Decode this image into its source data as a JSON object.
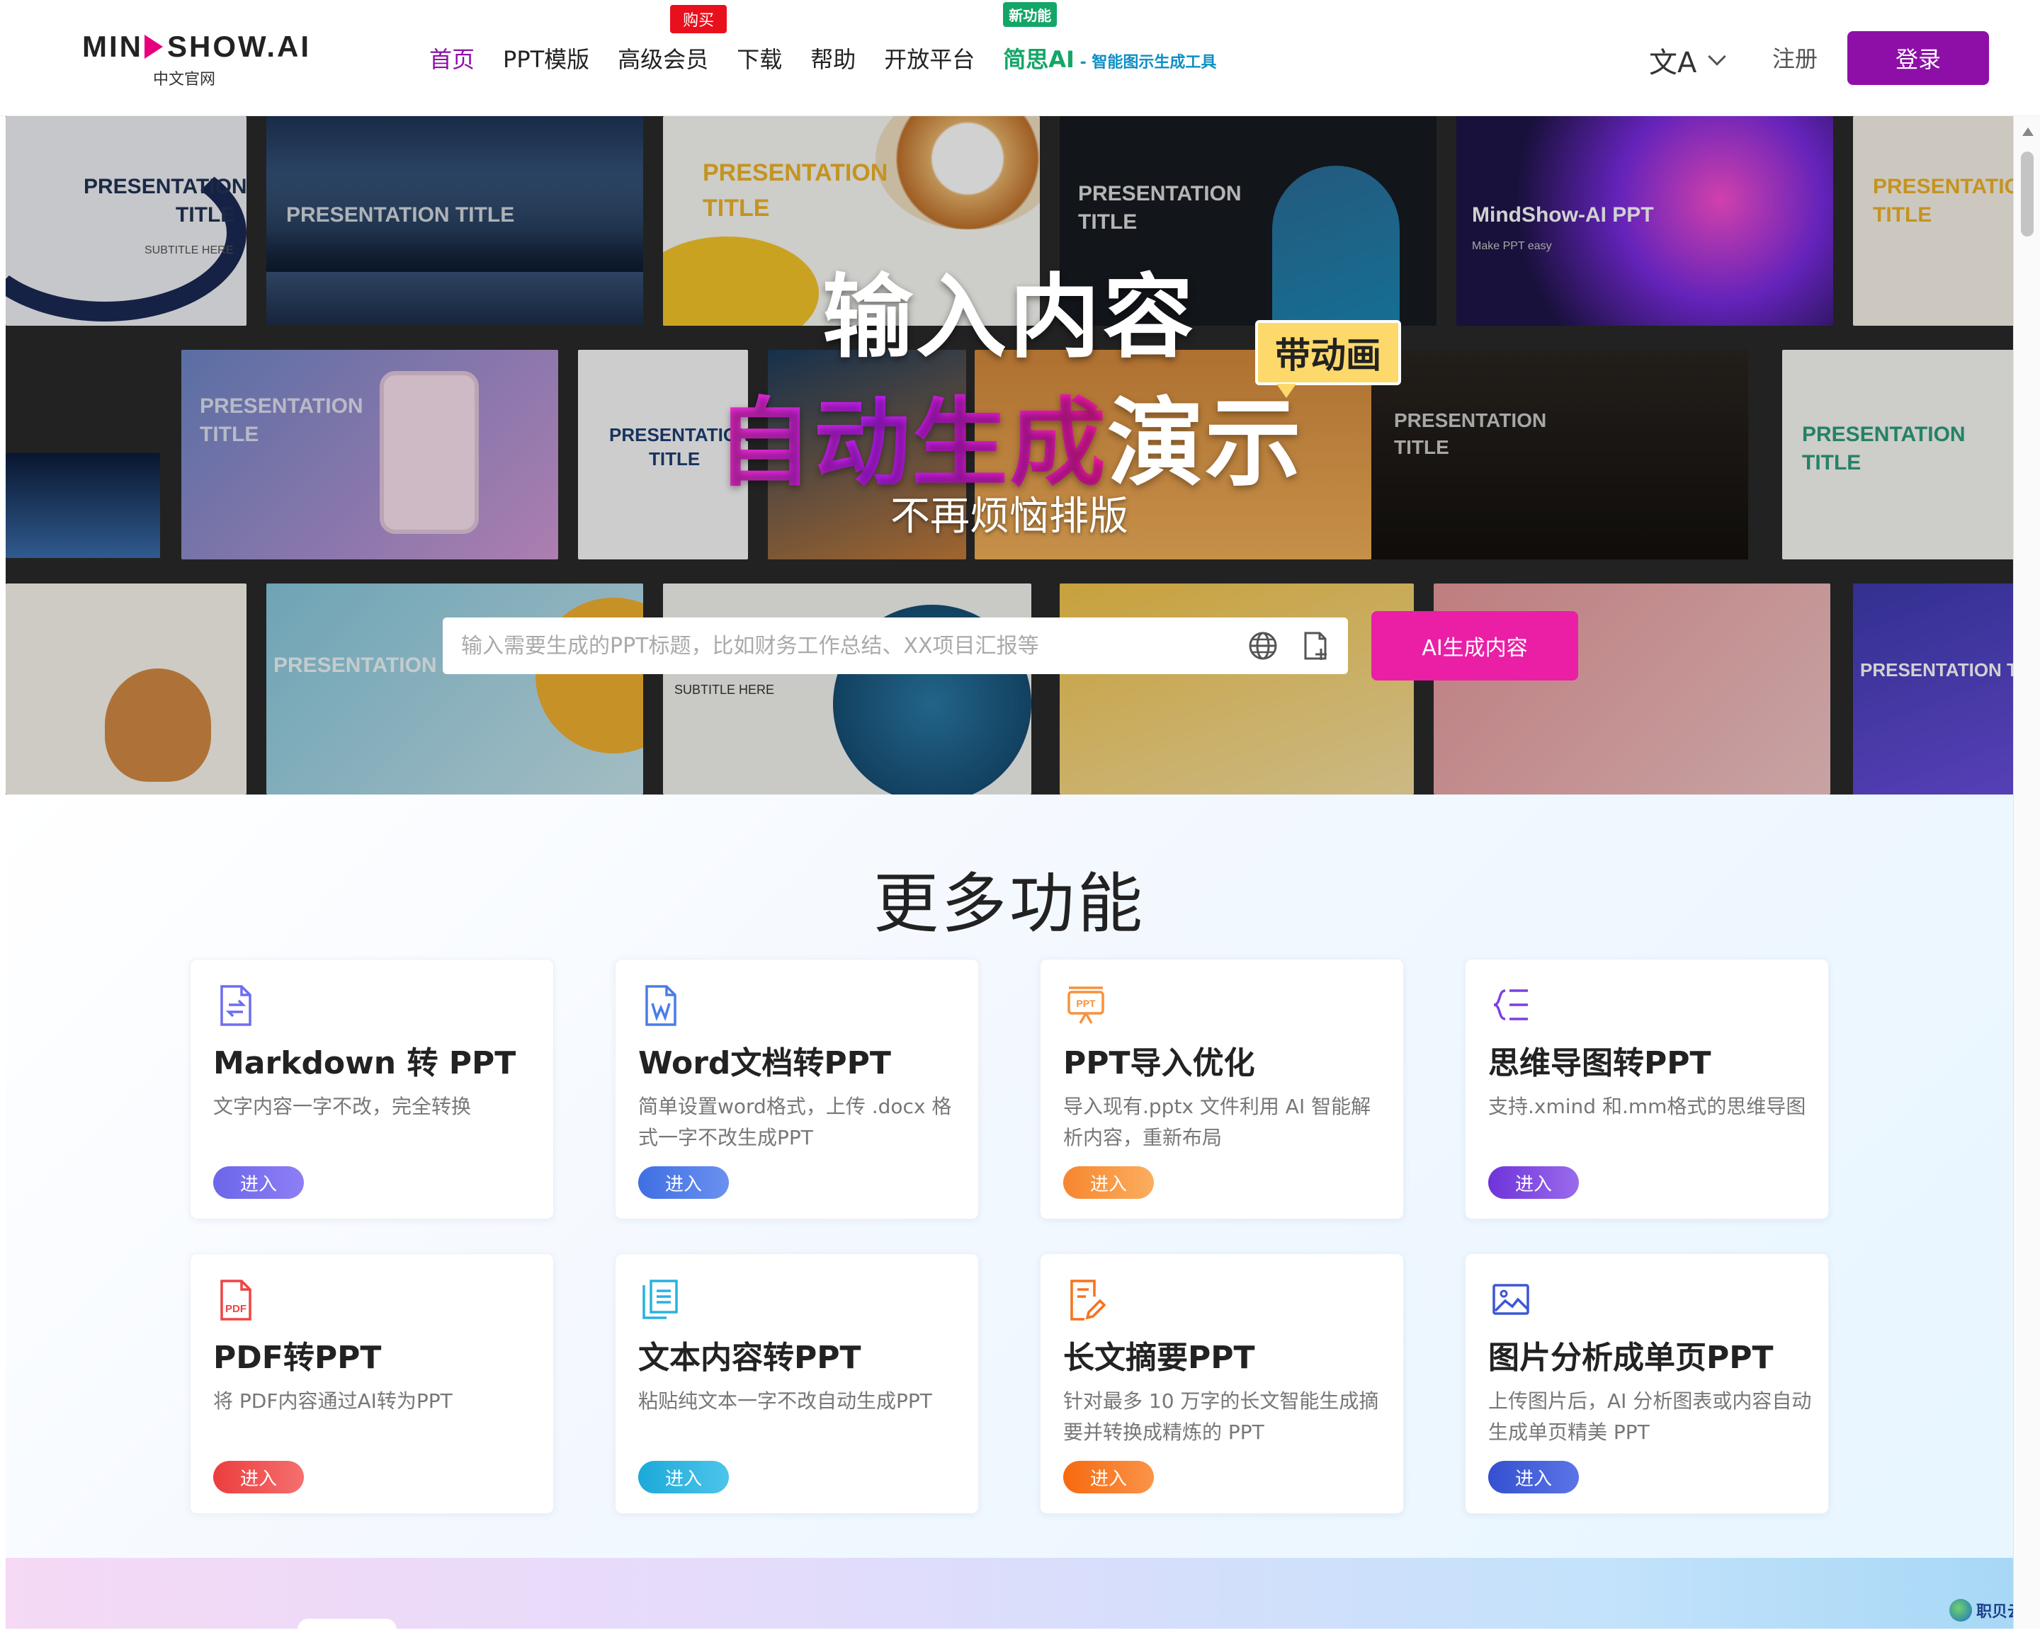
{
  "header": {
    "logo_main_a": "MIN",
    "logo_main_b": "SHOW.AI",
    "logo_sub": "中文官网",
    "nav": [
      {
        "label": "首页"
      },
      {
        "label": "PPT模版"
      },
      {
        "label": "高级会员",
        "badge": "购买"
      },
      {
        "label": "下载"
      },
      {
        "label": "帮助"
      },
      {
        "label": "开放平台"
      },
      {
        "label": "简思AI",
        "tail": " - 智能图示生成工具",
        "badge": "新功能"
      }
    ],
    "lang_icon": "文A",
    "register": "注册",
    "login": "登录"
  },
  "hero": {
    "line1": "输入内容",
    "line2_grad": "自动生成",
    "line2_white": "演示",
    "tag": "带动画",
    "line3": "不再烦恼排版",
    "search_placeholder": "输入需要生成的PPT标题，比如财务工作总结、XX项目汇报等",
    "ai_button": "AI生成内容",
    "thumb_texts": {
      "t1": "PRESENTATION",
      "t1b": "TITLE",
      "t1s": "SUBTITLE HERE",
      "t2": "PRESENTATION TITLE",
      "t3": "PRESENTATION",
      "t3b": "TITLE",
      "t4": "PRESENTATION",
      "t4b": "TITLE",
      "t5": "MindShow-AI PPT",
      "t5s": "Make PPT easy",
      "t6": "PRESENTATIO",
      "t6b": "TITLE",
      "t7": "PRESENTATION",
      "t7b": "TITLE",
      "t8": "PRESENTATION",
      "t8b": "TITLE",
      "t9": "PRESENTATION",
      "t9b": "TITLE",
      "t10": "PRESENTATION",
      "t10b": "TITLE",
      "t11": "PRESENTATION TITLE",
      "t12": "SUBTITLE HERE",
      "t13": "PRESENTATION TI"
    }
  },
  "features": {
    "title": "更多功能",
    "cards": [
      {
        "title": "Markdown 转 PPT",
        "desc": "文字内容一字不改，完全转换",
        "enter": "进入",
        "color": "#6e6df0",
        "icon": "markdown-file-icon"
      },
      {
        "title": "Word文档转PPT",
        "desc": "简单设置word格式，上传 .docx 格式一字不改生成PPT",
        "enter": "进入",
        "color": "#4a7de8",
        "icon": "word-file-icon"
      },
      {
        "title": "PPT导入优化",
        "desc": "导入现有.pptx 文件利用 AI 智能解析内容，重新布局",
        "enter": "进入",
        "color": "#f8913c",
        "icon": "ppt-icon"
      },
      {
        "title": "思维导图转PPT",
        "desc": "支持.xmind 和.mm格式的思维导图",
        "enter": "进入",
        "color": "#7b3fe0",
        "icon": "mindmap-icon"
      },
      {
        "title": "PDF转PPT",
        "desc": "将 PDF内容通过AI转为PPT",
        "enter": "进入",
        "color": "#ee4545",
        "icon": "pdf-file-icon"
      },
      {
        "title": "文本内容转PPT",
        "desc": "粘贴纯文本一字不改自动生成PPT",
        "enter": "进入",
        "color": "#27b2de",
        "icon": "text-document-icon"
      },
      {
        "title": "长文摘要PPT",
        "desc": "针对最多 10 万字的长文智能生成摘要并转换成精炼的 PPT",
        "enter": "进入",
        "color": "#f7731b",
        "icon": "summary-edit-icon"
      },
      {
        "title": "图片分析成单页PPT",
        "desc": "上传图片后，AI 分析图表或内容自动生成单页精美 PPT",
        "enter": "进入",
        "color": "#3c57d3",
        "icon": "image-icon"
      }
    ]
  },
  "watermark": "职贝云数"
}
